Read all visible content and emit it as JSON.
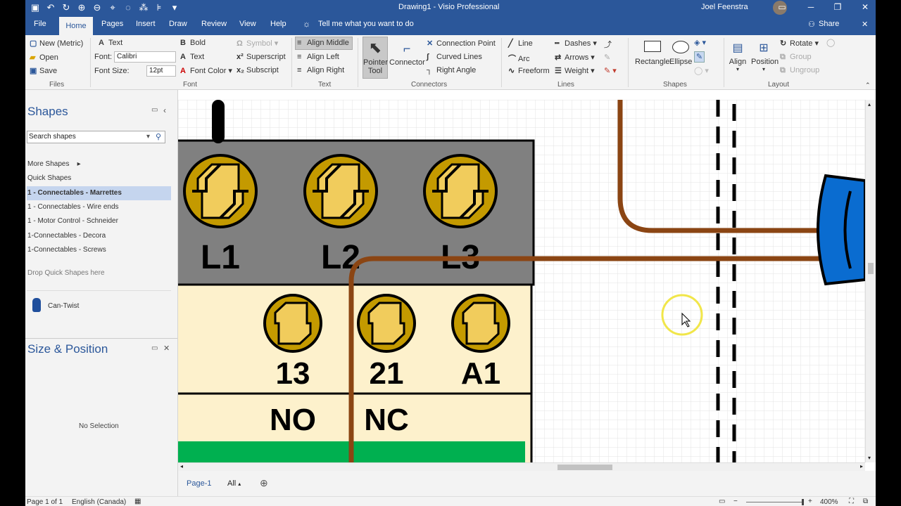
{
  "window": {
    "title": "Drawing1  -  Visio Professional",
    "user": "Joel Feenstra"
  },
  "tabs": [
    "File",
    "Home",
    "Pages",
    "Insert",
    "Draw",
    "Review",
    "View",
    "Help"
  ],
  "tell_me": "Tell me what you want to do",
  "share": "Share",
  "ribbon": {
    "files": {
      "new": "New (Metric)",
      "open": "Open",
      "save": "Save",
      "label": "Files"
    },
    "font": {
      "text": "Text",
      "font_label": "Font:",
      "font_value": "Calibri",
      "size_label": "Font Size:",
      "size_value": "12pt",
      "bold": "Bold",
      "text2": "Text",
      "font_color": "Font Color",
      "symbol": "Symbol",
      "superscript": "Superscript",
      "subscript": "Subscript",
      "label": "Font"
    },
    "text": {
      "align_middle": "Align Middle",
      "align_left": "Align Left",
      "align_right": "Align Right",
      "label": "Text"
    },
    "connectors": {
      "pointer": "Pointer Tool",
      "connector": "Connector",
      "connection_point": "Connection Point",
      "curved": "Curved Lines",
      "right_angle": "Right Angle",
      "label": "Connectors"
    },
    "lines": {
      "line": "Line",
      "arc": "Arc",
      "freeform": "Freeform",
      "dashes": "Dashes",
      "arrows": "Arrows",
      "weight": "Weight",
      "label": "Lines"
    },
    "shapes": {
      "rectangle": "Rectangle",
      "ellipse": "Ellipse",
      "label": "Shapes"
    },
    "layout": {
      "align": "Align",
      "position": "Position",
      "rotate": "Rotate",
      "group": "Group",
      "ungroup": "Ungroup",
      "label": "Layout"
    }
  },
  "shapes_pane": {
    "title": "Shapes",
    "search_placeholder": "Search shapes",
    "more_shapes": "More Shapes",
    "quick_shapes": "Quick Shapes",
    "stencils": [
      "1 - Connectables - Marrettes",
      "1 - Connectables - Wire ends",
      "1 - Motor Control - Schneider",
      "1-Connectables - Decora",
      "1-Connectables - Screws"
    ],
    "drop_hint": "Drop Quick Shapes here",
    "shape_item": "Can-Twist"
  },
  "size_pane": {
    "title": "Size & Position",
    "status": "No Selection"
  },
  "diagram": {
    "top_labels": [
      "L1",
      "L2",
      "L3"
    ],
    "mid_labels": [
      "13",
      "21",
      "A1"
    ],
    "bottom_labels": [
      "NO",
      "NC"
    ]
  },
  "page_tabs": {
    "page": "Page-1",
    "all": "All"
  },
  "status": {
    "page": "Page 1 of 1",
    "language": "English (Canada)",
    "zoom": "400%"
  },
  "colors": {
    "accent": "#2b579a",
    "terminal_gold": "#c49a00",
    "wire_brown": "#8b4513",
    "contactor_gray": "#808080",
    "panel_cream": "#fdf1cc",
    "green_bar": "#00b050",
    "blue_shape": "#0a6cd0"
  }
}
